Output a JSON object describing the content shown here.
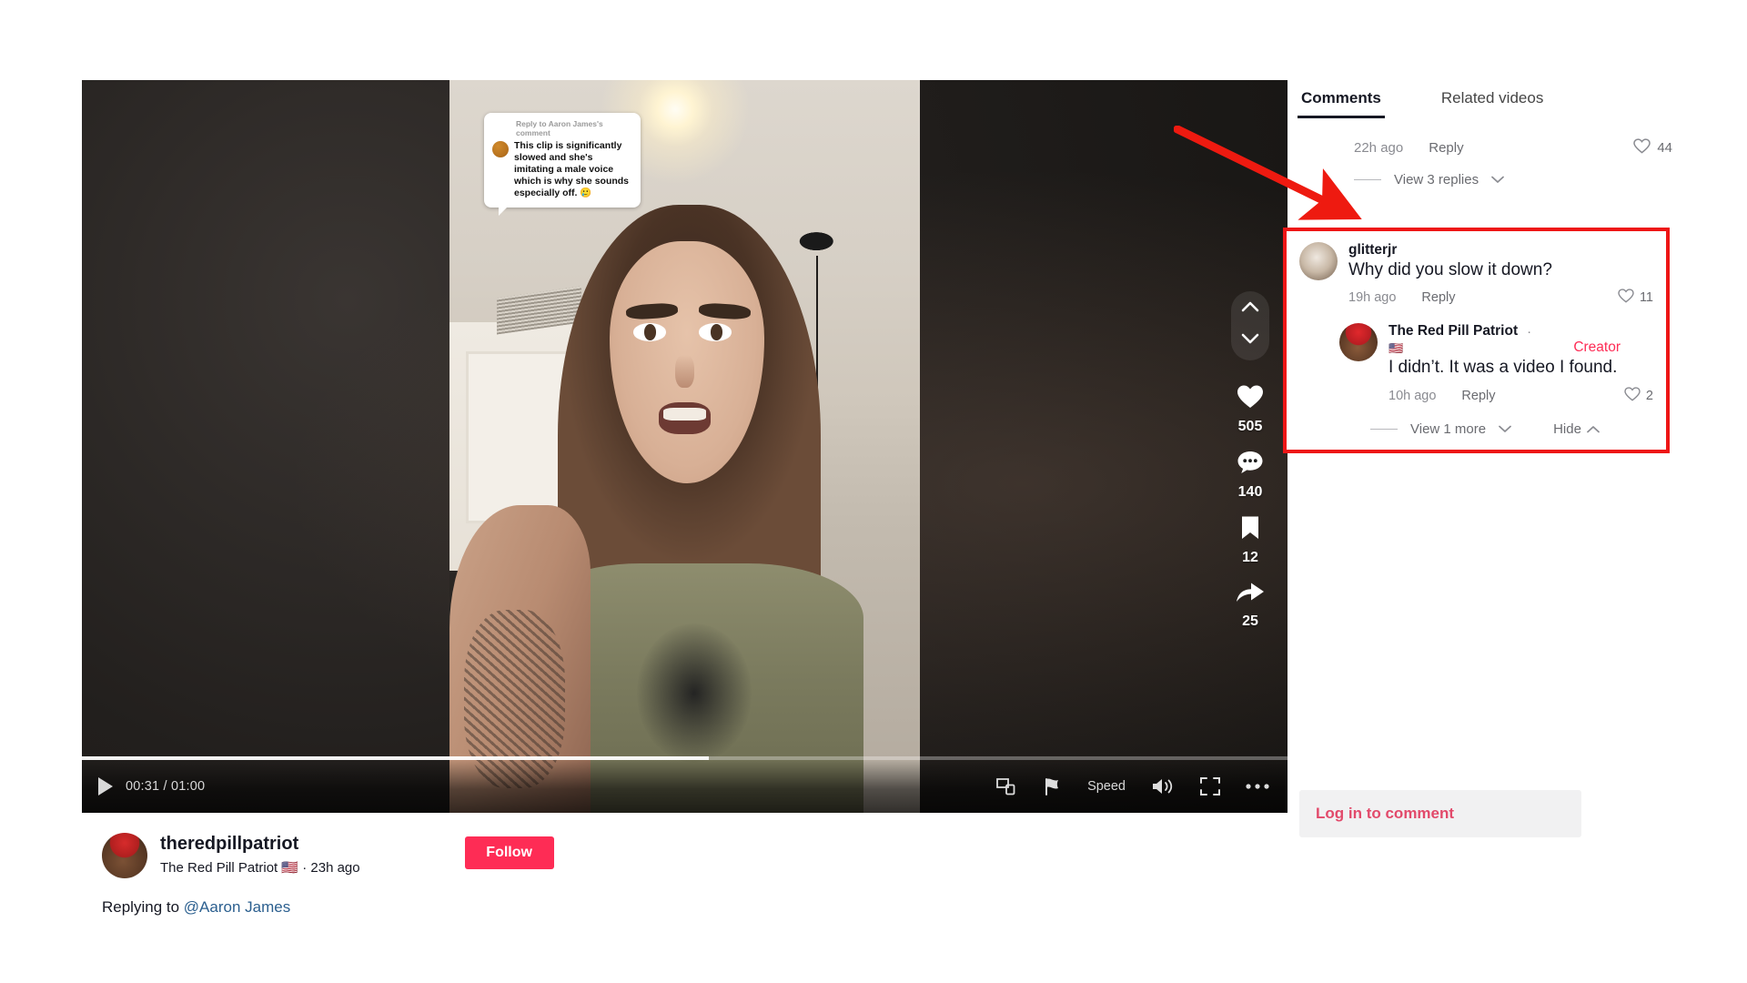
{
  "video": {
    "caption_overlay": {
      "reply_ref": "Reply to Aaron James's comment",
      "text": "This clip is significantly slowed and she's imitating a male voice which is why she sounds especially off. 🥲"
    },
    "controls": {
      "play_label": "play-icon",
      "time": "00:31 / 01:00",
      "speed_label": "Speed",
      "progress_percent": 52,
      "icons": [
        "picture-in-picture-icon",
        "flag-icon",
        "volume-icon",
        "fullscreen-icon",
        "more-options-icon"
      ]
    },
    "rail": {
      "nav": [
        "chevron-up-icon",
        "chevron-down-icon"
      ],
      "actions": [
        {
          "icon": "heart-icon",
          "count": "505"
        },
        {
          "icon": "comment-icon",
          "count": "140"
        },
        {
          "icon": "bookmark-icon",
          "count": "12"
        },
        {
          "icon": "share-icon",
          "count": "25"
        }
      ]
    }
  },
  "author": {
    "username": "theredpillpatriot",
    "display_name": "The Red Pill Patriot 🇺🇸 · 23h ago",
    "follow_label": "Follow",
    "caption_prefix": "Replying to ",
    "caption_mention": "@Aaron James"
  },
  "panel": {
    "tabs": [
      {
        "label": "Comments",
        "active": true
      },
      {
        "label": "Related videos",
        "active": false
      }
    ],
    "top_comment_meta": {
      "time": "22h ago",
      "reply_label": "Reply",
      "likes": "44"
    },
    "view_replies_label": "View 3 replies",
    "highlighted": {
      "comment": {
        "username": "glitterjr",
        "text": "Why did you slow it down?",
        "time": "19h ago",
        "reply_label": "Reply",
        "likes": "11"
      },
      "reply": {
        "username": "The Red Pill Patriot",
        "separator": "·",
        "flag": "🇺🇸",
        "badge": "Creator",
        "text": "I didn’t. It was a video I found.",
        "time": "10h ago",
        "reply_label": "Reply",
        "likes": "2"
      },
      "view_more_label": "View 1 more",
      "hide_label": "Hide"
    },
    "login_prompt": "Log in to comment"
  },
  "colors": {
    "accent": "#fe2c55",
    "highlight_border": "#ee1616",
    "arrow": "#ee1a10",
    "text": "#161823",
    "muted": "#8a8b91"
  }
}
